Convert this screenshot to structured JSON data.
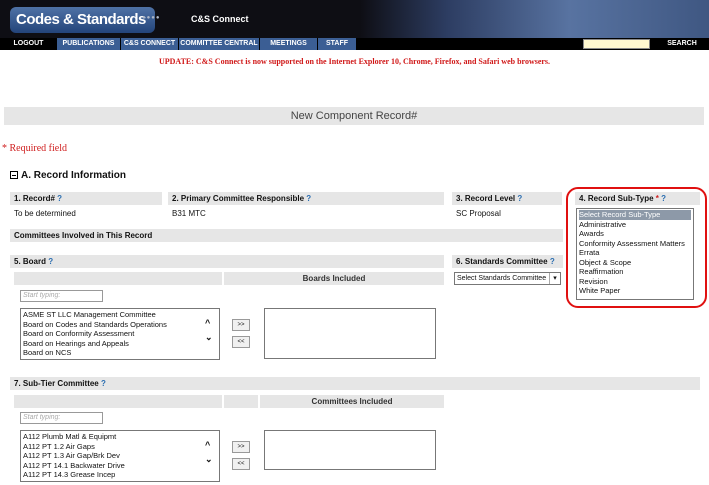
{
  "banner": {
    "logo_text": "Codes & Standards",
    "dots": "●●●●",
    "subtitle": "C&S Connect"
  },
  "nav": {
    "items": [
      "LOGOUT",
      "PUBLICATIONS",
      "C&S CONNECT",
      "COMMITTEE CENTRAL",
      "MEETINGS",
      "STAFF"
    ],
    "search_label": "SEARCH"
  },
  "update_message": "UPDATE: C&S Connect is now supported on the Internet Explorer 10, Chrome, Firefox, and Safari web browsers.",
  "page_title": "New Component Record#",
  "required_note": "* Required field",
  "section_a": {
    "toggle": "⊟",
    "title": "A. Record Information"
  },
  "fields": {
    "record_num": {
      "label": "1. Record#",
      "help": "?",
      "value": "To be determined"
    },
    "primary_committee": {
      "label": "2. Primary Committee Responsible",
      "help": "?",
      "value": "B31 MTC"
    },
    "record_level": {
      "label": "3. Record Level",
      "help": "?",
      "value": "SC Proposal"
    },
    "record_subtype": {
      "label": "4. Record Sub-Type",
      "required_mark": "*",
      "help": "?",
      "options": [
        "Select Record Sub-Type",
        "Administrative",
        "Awards",
        "Conformity Assessment Matters",
        "Errata",
        "Object & Scope",
        "Reaffirmation",
        "Revision",
        "White Paper"
      ],
      "selected_index": 0
    }
  },
  "committees_involved": "Committees Involved in This Record",
  "board": {
    "label": "5. Board",
    "help": "?",
    "included_header": "Boards Included",
    "filter_placeholder": "Start typing:",
    "options": [
      "ASME ST LLC Management Committee",
      "Board on Codes and Standards Operations",
      "Board on Conformity Assessment",
      "Board on Hearings and Appeals",
      "Board on NCS"
    ],
    "add_label": ">>",
    "remove_label": "<<"
  },
  "standards_committee": {
    "label": "6. Standards Committee",
    "help": "?",
    "select_value": "Select Standards Committee"
  },
  "subtier": {
    "label": "7. Sub-Tier Committee",
    "help": "?",
    "included_header": "Committees Included",
    "filter_placeholder": "Start typing:",
    "options": [
      "A112 Plumb Matl & Equipmt",
      "A112 PT 1.2 Air Gaps",
      "A112 PT 1.3 Air Gap/Brk Dev",
      "A112 PT 14.1 Backwater Drive",
      "A112 PT 14.3 Grease Incep"
    ],
    "add_label": ">>",
    "remove_label": "<<"
  },
  "icons": {
    "scroll_up": "^",
    "scroll_down": "⌄",
    "dropdown": "▾"
  },
  "colors": {
    "nav_blue": "#3b5e94",
    "update_red": "#d01818",
    "help_blue": "#2a6db0",
    "highlight_red": "#e01010"
  }
}
